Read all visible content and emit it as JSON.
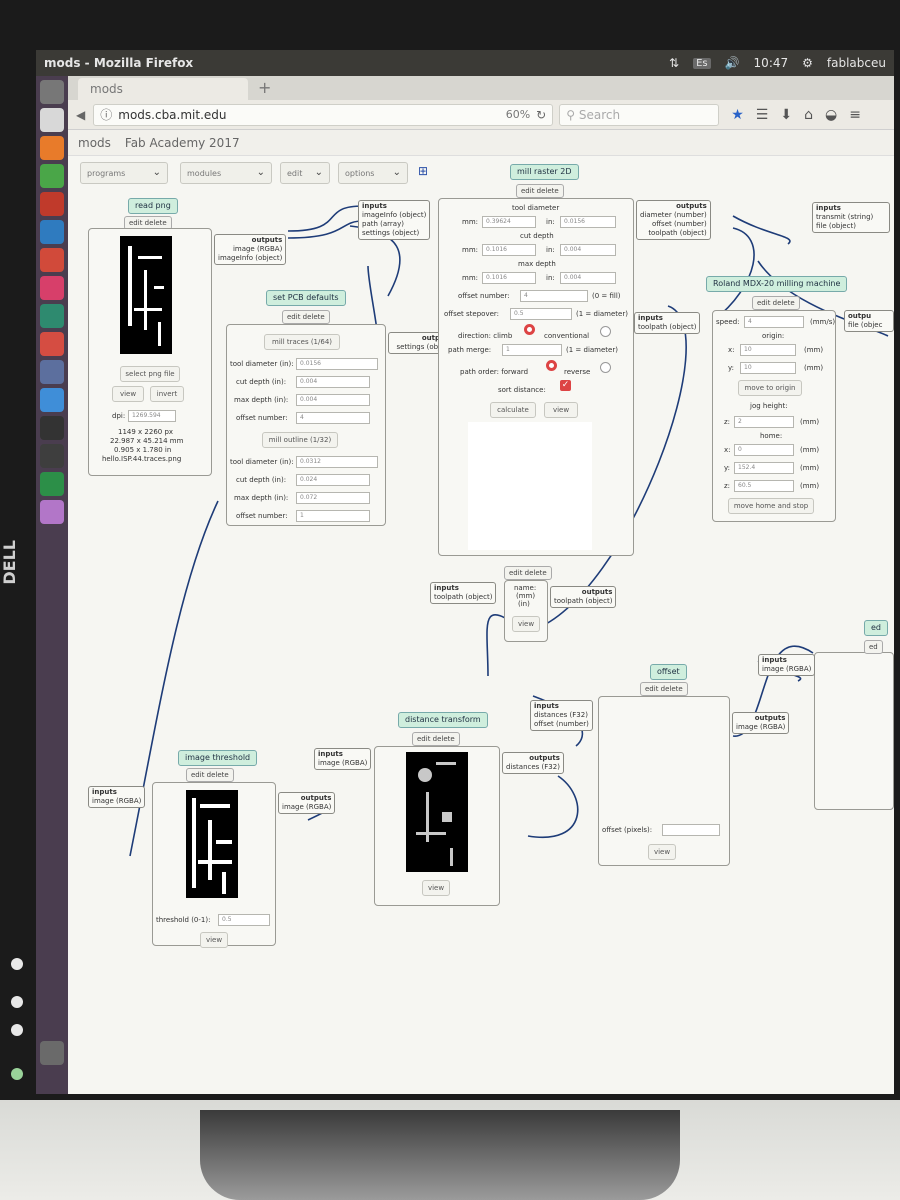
{
  "window_title": "mods - Mozilla Firefox",
  "tray": {
    "keyboard": "Es",
    "time": "10:47",
    "user": "fablabceu"
  },
  "browser": {
    "tab_label": "mods",
    "url": "mods.cba.mit.edu",
    "zoom": "60%",
    "search_placeholder": "Search",
    "bookmarks": [
      "mods",
      "Fab Academy 2017"
    ]
  },
  "menus": [
    "programs",
    "modules",
    "edit",
    "options"
  ],
  "common": {
    "edit_delete": "edit delete",
    "inputs": "inputs",
    "outputs": "outputs",
    "view": "view"
  },
  "read_png": {
    "title": "read png",
    "output_image": "image (RGBA)",
    "output_info": "imageInfo (object)",
    "select_btn": "select png file",
    "view_btn": "view",
    "invert_btn": "invert",
    "dpi_label": "dpi:",
    "dpi_value": "1269.594",
    "px_size": "1149 x 2260 px",
    "mm_size": "22.987 x 45.214 mm",
    "in_size": "0.905 x 1.780 in",
    "filename": "hello.ISP.44.traces.png"
  },
  "set_pcb": {
    "title": "set PCB defaults",
    "mill_traces": "mill traces (1/64)",
    "mill_outline": "mill outline (1/32)",
    "labels": [
      "tool diameter (in):",
      "cut depth (in):",
      "max depth (in):",
      "offset number:"
    ],
    "traces_values": [
      "0.0156",
      "0.004",
      "0.004",
      "4"
    ],
    "outline_values": [
      "0.0312",
      "0.024",
      "0.072",
      "1"
    ],
    "output_partial": "outp",
    "output_settings": "settings (obj"
  },
  "mill_raster": {
    "title": "mill raster 2D",
    "inputs": [
      "imageInfo (object)",
      "path (array)",
      "settings (object)"
    ],
    "outputs": [
      "diameter (number)",
      "offset (number)",
      "toolpath (object)"
    ],
    "tool_diameter": "tool diameter",
    "cut_depth": "cut depth",
    "max_depth": "max depth",
    "mm": "mm:",
    "in": "in:",
    "tool_mm": "0.39624",
    "tool_in": "0.0156",
    "cut_mm": "0.1016",
    "cut_in": "0.004",
    "max_mm": "0.1016",
    "max_in": "0.004",
    "offset_number_label": "offset number:",
    "offset_number": "4",
    "offset_number_note": "(0 = fill)",
    "stepover_label": "offset stepover:",
    "stepover": "0.5",
    "stepover_note": "(1 = diameter)",
    "direction_label": "direction: climb",
    "conventional": "conventional",
    "merge_label": "path merge:",
    "merge": "1",
    "merge_note": "(1 = diameter)",
    "order_label": "path order: forward",
    "reverse": "reverse",
    "sort_label": "sort distance:",
    "calculate": "calculate",
    "view": "view"
  },
  "roland": {
    "title": "Roland MDX-20 milling machine",
    "input": "toolpath (object)",
    "speed_label": "speed:",
    "speed": "4",
    "speed_unit": "(mm/s)",
    "origin": "origin:",
    "x_label": "x:",
    "y_label": "y:",
    "z_label": "z:",
    "origin_x": "10",
    "origin_y": "10",
    "mm_unit": "(mm)",
    "move_origin": "move to origin",
    "jog": "jog height:",
    "jog_z": "2",
    "home": "home:",
    "home_x": "0",
    "home_y": "152.4",
    "home_z": "60.5",
    "move_home": "move home and stop",
    "output_partial": "outpu",
    "output_file": "file (objec"
  },
  "save_file": {
    "inputs_label": "inputs",
    "transmit": "transmit (string)",
    "file": "file (object)"
  },
  "view_toolpath": {
    "input": "toolpath (object)",
    "output": "toolpath (object)",
    "name": "name:",
    "mm": "(mm)",
    "in": "(in)",
    "view": "view"
  },
  "offset": {
    "title": "offset",
    "inputs": [
      "distances (F32)",
      "offset (number)"
    ],
    "output": "image (RGBA)",
    "offset_label": "offset (pixels):"
  },
  "edge": {
    "input": "image (RGBA)",
    "title_partial": "ed",
    "edit_partial": "ed"
  },
  "distance_transform": {
    "title": "distance transform",
    "input": "image (RGBA)",
    "output": "distances (F32)"
  },
  "image_threshold": {
    "title": "image threshold",
    "input": "image (RGBA)",
    "output": "image (RGBA)",
    "threshold_label": "threshold (0-1):",
    "threshold": "0.5"
  },
  "bezel_brand": "DELL"
}
